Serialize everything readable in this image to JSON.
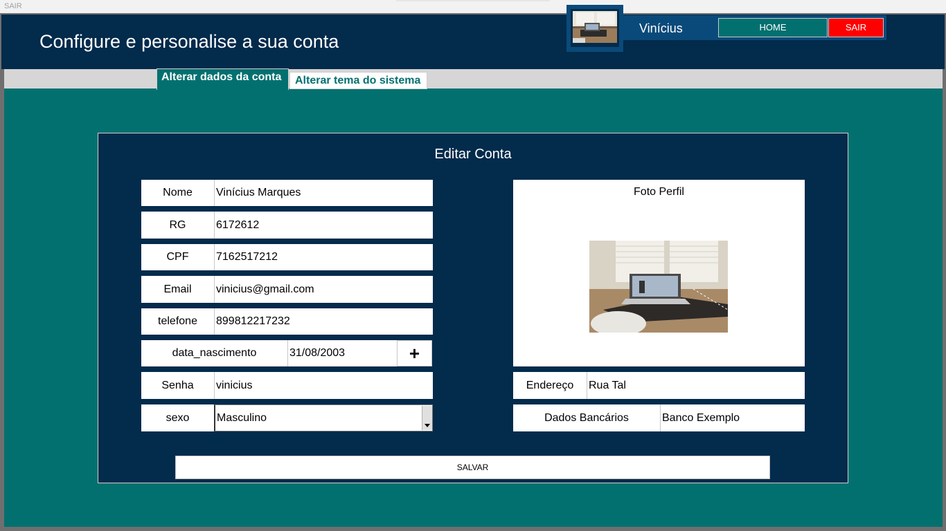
{
  "window": {
    "title": "SAIR"
  },
  "header": {
    "title": "Configure e personalise a sua conta",
    "username": "Vinícius",
    "home_label": "HOME",
    "sair_label": "SAIR"
  },
  "tabs": [
    {
      "label": "Alterar dados da conta",
      "active": true
    },
    {
      "label": "Alterar tema do sistema",
      "active": false
    }
  ],
  "form": {
    "title": "Editar Conta",
    "fields": {
      "nome": {
        "label": "Nome",
        "value": "Vinícius Marques"
      },
      "rg": {
        "label": "RG",
        "value": "6172612"
      },
      "cpf": {
        "label": "CPF",
        "value": "7162517212"
      },
      "email": {
        "label": "Email",
        "value": "vinicius@gmail.com"
      },
      "telefone": {
        "label": "telefone",
        "value": "899812217232"
      },
      "data_nascimento": {
        "label": "data_nascimento",
        "value": "31/08/2003",
        "button": "+"
      },
      "senha": {
        "label": "Senha",
        "value": "vinicius"
      },
      "sexo": {
        "label": "sexo",
        "value": "Masculino"
      },
      "endereco": {
        "label": "Endereço",
        "value": "Rua Tal"
      },
      "dados_bancarios": {
        "label": "Dados Bancários",
        "value": "Banco Exemplo"
      }
    },
    "photo_caption": "Foto Perfil",
    "save_label": "SALVAR"
  },
  "colors": {
    "navy": "#022b4c",
    "teal": "#037070",
    "userbar": "#0a4a7a",
    "danger": "#ff0000"
  },
  "icons": {
    "avatar": "laptop-desk-photo",
    "profile_photo": "laptop-desk-photo",
    "dropdown": "chevron-down-icon"
  }
}
